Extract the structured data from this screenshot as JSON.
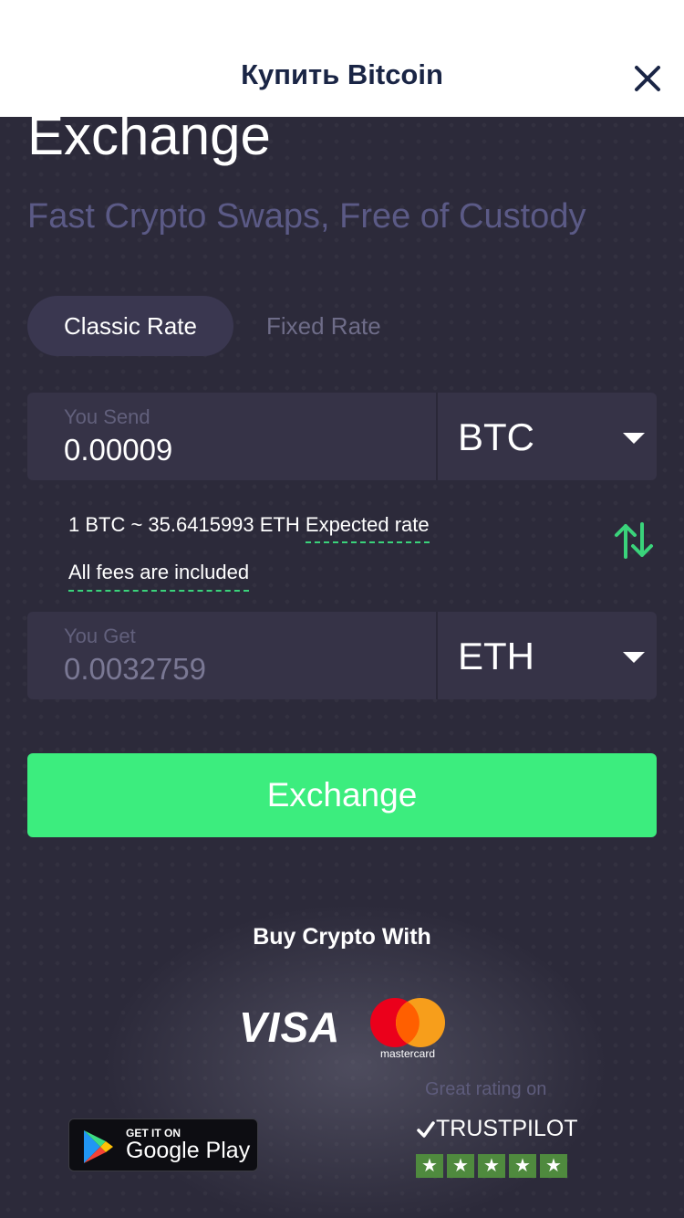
{
  "header": {
    "title": "Купить Bitcoin"
  },
  "hero": {
    "title": "Exchange",
    "subtitle": "Fast Crypto Swaps, Free of Custody"
  },
  "rate_tabs": [
    {
      "label": "Classic Rate",
      "active": true
    },
    {
      "label": "Fixed Rate",
      "active": false
    }
  ],
  "send": {
    "label": "You Send",
    "value": "0.00009",
    "currency": "BTC"
  },
  "rate": {
    "text": "1 BTC ~ 35.6415993 ETH",
    "expected_label": "Expected rate",
    "fees_label": "All fees are included"
  },
  "receive": {
    "label": "You Get",
    "value": "0.0032759",
    "currency": "ETH"
  },
  "exchange_button": {
    "label": "Exchange"
  },
  "payment": {
    "title": "Buy Crypto With",
    "visa": "VISA",
    "mastercard": "mastercard"
  },
  "google_play": {
    "small": "GET IT ON",
    "big": "Google Play"
  },
  "trustpilot": {
    "label": "Great rating on",
    "brand": "TRUSTPILOT",
    "stars": 5,
    "star_color": "#4f8a3e"
  },
  "colors": {
    "accent": "#3ced7e",
    "background": "#2c2a3a",
    "field": "#363347",
    "header_text": "#1a2545"
  }
}
